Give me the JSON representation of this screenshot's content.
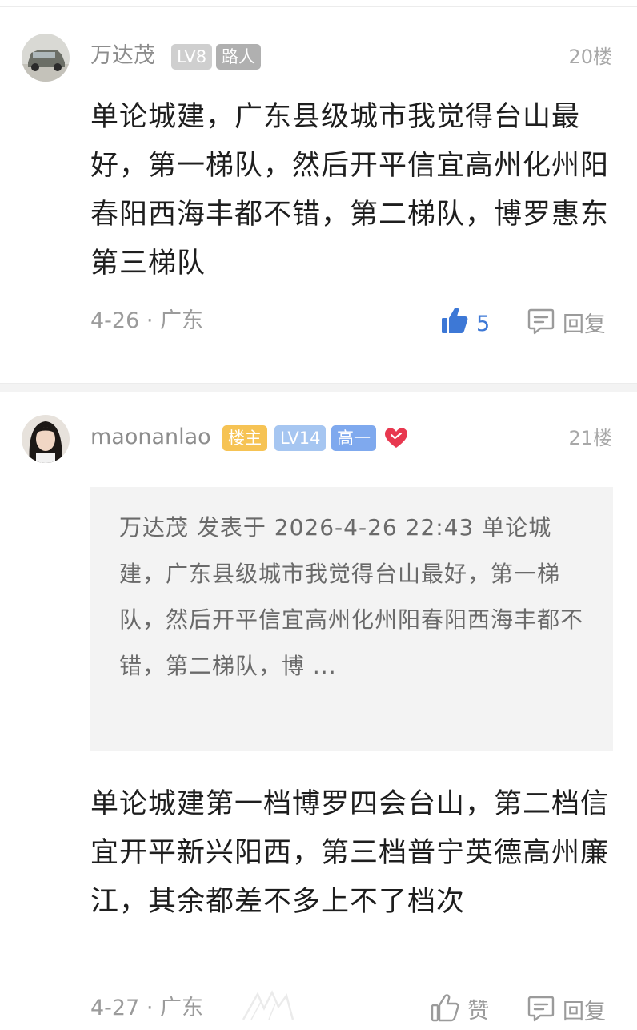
{
  "posts": [
    {
      "username": "万达茂",
      "badges": [
        {
          "text": "LV8",
          "color": "#cfcfcf"
        },
        {
          "text": "路人",
          "color": "#b0b0b0"
        }
      ],
      "floor": "20楼",
      "content": "单论城建，广东县级城市我觉得台山最好，第一梯队，然后开平信宜高州化州阳春阳西海丰都不错，第二梯队，博罗惠东第三梯队",
      "meta": "4-26 · 广东",
      "like_count": "5",
      "reply_label": "回复",
      "icons": {
        "like": "thumbs-up-filled-icon",
        "reply": "comment-icon"
      },
      "like_color": "#3d78d6"
    },
    {
      "username": "maonanlao",
      "badges": [
        {
          "text": "楼主",
          "color": "#f6c354"
        },
        {
          "text": "LV14",
          "color": "#a6c6f1"
        },
        {
          "text": "高一",
          "color": "#7fa9ee"
        }
      ],
      "floor": "21楼",
      "quote": "万达茂 发表于 2026-4-26 22:43 单论城建，广东县级城市我觉得台山最好，第一梯队，然后开平信宜高州化州阳春阳西海丰都不错，第二梯队，博 ...",
      "content": "单论城建第一档博罗四会台山，第二档信宜开平新兴阳西，第三档普宁英德高州廉江，其余都差不多上不了档次",
      "meta": "4-27 · 广东",
      "like_label": "赞",
      "reply_label": "回复",
      "icons": {
        "like": "thumbs-up-outline-icon",
        "reply": "comment-icon",
        "badge": "heart-icon"
      },
      "heart_color": "#e8384f"
    }
  ]
}
